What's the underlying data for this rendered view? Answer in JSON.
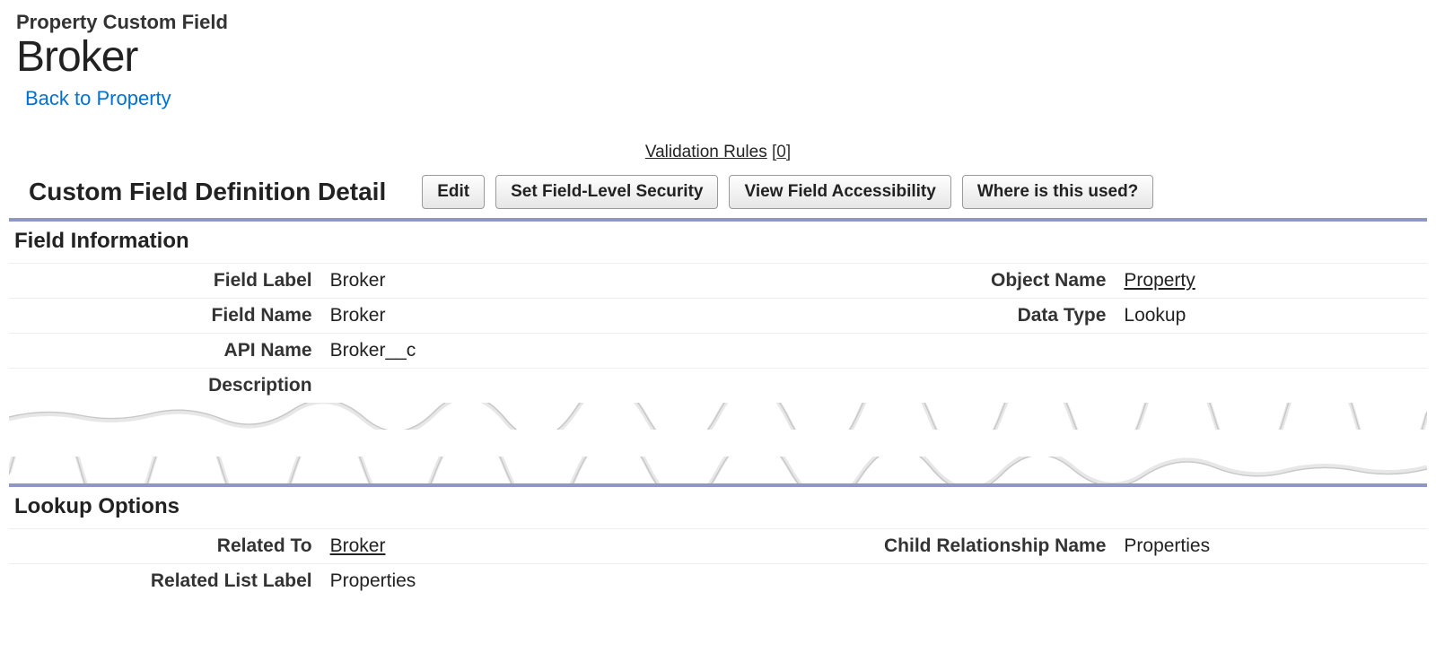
{
  "header": {
    "breadcrumb": "Property Custom Field",
    "title": "Broker",
    "back_link": "Back to Property"
  },
  "validation": {
    "label": "Validation Rules",
    "count": "0"
  },
  "detail_header": {
    "title": "Custom Field Definition Detail",
    "buttons": {
      "edit": "Edit",
      "set_fls": "Set Field-Level Security",
      "view_accessibility": "View Field Accessibility",
      "where_used": "Where is this used?"
    }
  },
  "sections": {
    "field_info": {
      "title": "Field Information",
      "rows": {
        "field_label": {
          "label": "Field Label",
          "value": "Broker"
        },
        "object_name": {
          "label": "Object Name",
          "value": "Property"
        },
        "field_name": {
          "label": "Field Name",
          "value": "Broker"
        },
        "data_type": {
          "label": "Data Type",
          "value": "Lookup"
        },
        "api_name": {
          "label": "API Name",
          "value": "Broker__c"
        },
        "description": {
          "label": "Description",
          "value": ""
        }
      }
    },
    "lookup_options": {
      "title": "Lookup Options",
      "rows": {
        "related_to": {
          "label": "Related To",
          "value": "Broker"
        },
        "child_rel": {
          "label": "Child Relationship Name",
          "value": "Properties"
        },
        "related_list_label": {
          "label": "Related List Label",
          "value": "Properties"
        }
      }
    }
  }
}
